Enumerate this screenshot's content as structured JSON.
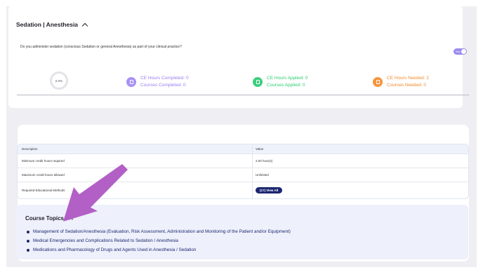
{
  "section": {
    "title": "Sedation | Anesthesia",
    "question": "Do you administer sedation (conscious Sedation or general Anesthesia) as part of your clinical practice?",
    "toggle_label": "Yes",
    "progress_label": "0.0%"
  },
  "stats": {
    "completed": {
      "hours": "CE Hours Completed: 0",
      "courses": "Courses Completed: 0",
      "color": "#9b7df2"
    },
    "applied": {
      "hours": "CE Hours Applied: 0",
      "courses": "Courses Applied: 0",
      "color": "#2ecc71"
    },
    "needed": {
      "hours": "CE Hours Needed: 2",
      "courses": "Courses Needed: 0",
      "color": "#f08a2c"
    }
  },
  "table": {
    "headers": [
      "Description",
      "Value"
    ],
    "rows": [
      {
        "description": "Minimum credit hours required",
        "value": "2.00 hour(s)"
      },
      {
        "description": "Maximum credit hours allowed",
        "value": "Unlimited"
      },
      {
        "description": "Required Educational Methods",
        "value": "(17) View All"
      }
    ]
  },
  "topics": {
    "title": "Course Topics",
    "items": [
      "Management of Sedation/Anesthesia (Evaluation, Risk Assessment, Administration and Monitoring of the Patient and/or Equipment)",
      "Medical Emergencies and Complications Related to Sedation / Anesthesia",
      "Medications and Pharmacology of Drugs and Agents Used in Anesthesia / Sedation"
    ]
  },
  "annotation": {
    "arrow_color": "#b25fc6"
  }
}
